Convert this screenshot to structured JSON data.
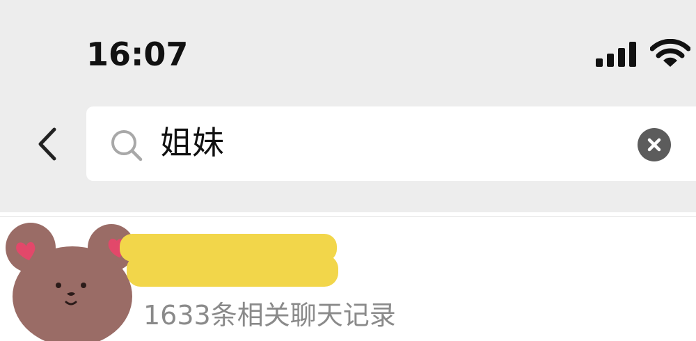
{
  "status_bar": {
    "time": "16:07",
    "signal_icon": "cellular-signal-icon",
    "wifi_icon": "wifi-icon"
  },
  "search": {
    "back_icon": "chevron-left-icon",
    "search_icon": "search-icon",
    "query": "姐妹",
    "clear_icon": "clear-circle-icon"
  },
  "results": [
    {
      "avatar_icon": "bear-avatar-icon",
      "name_redacted": true,
      "meta": "1633条相关聊天记录"
    }
  ],
  "colors": {
    "header_background": "#ededed",
    "redaction_marker": "#f2d64a",
    "avatar_brown": "#9a6c66",
    "avatar_heart": "#e2486a",
    "meta_text": "#8a8a8a",
    "clear_button": "#5c5c5c"
  }
}
